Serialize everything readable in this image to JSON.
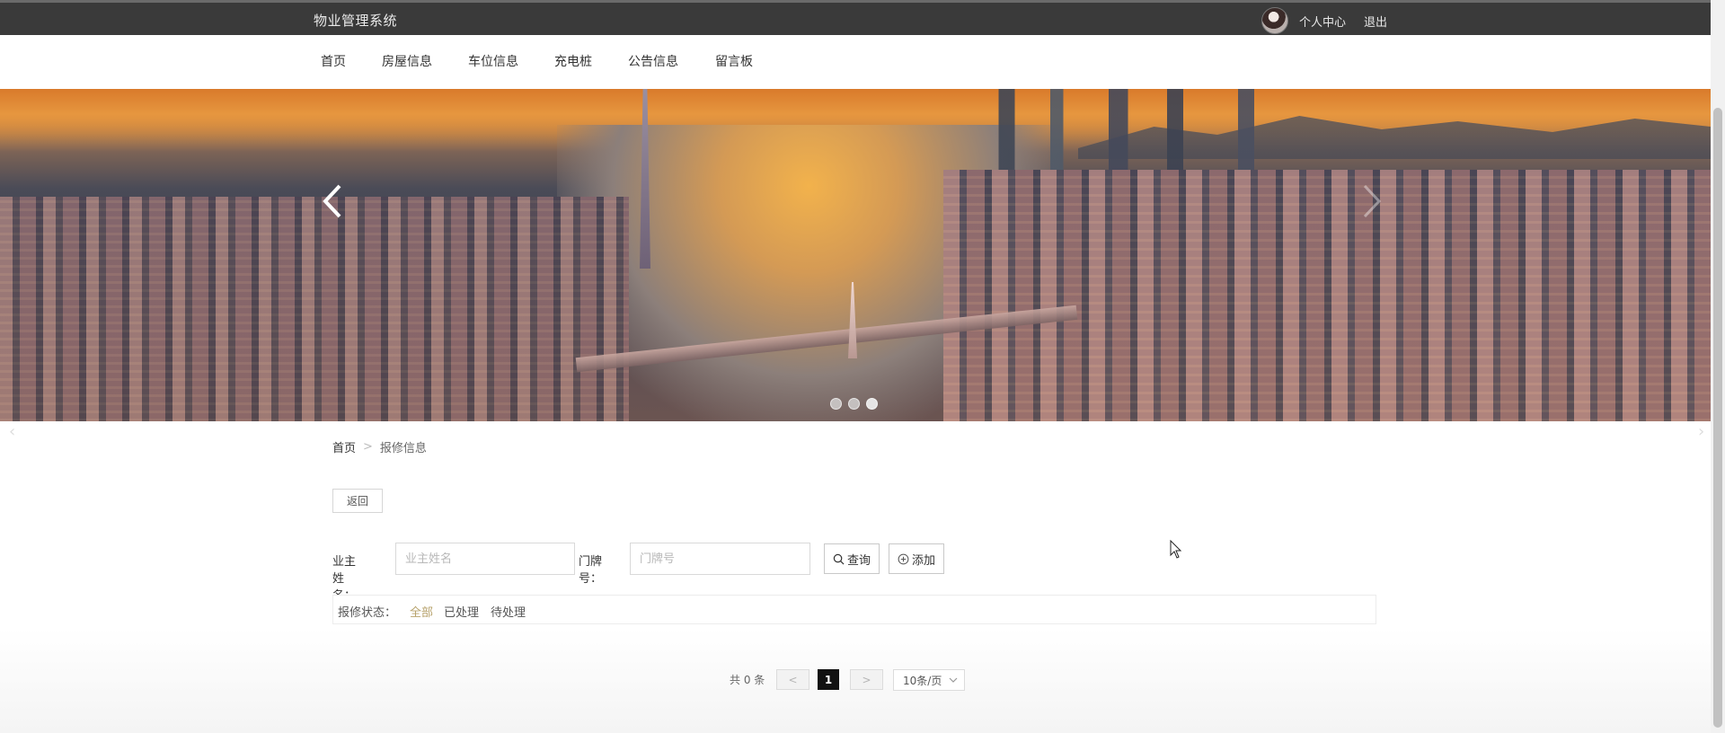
{
  "header": {
    "title": "物业管理系统",
    "personal_center": "个人中心",
    "logout": "退出"
  },
  "nav": {
    "items": [
      "首页",
      "房屋信息",
      "车位信息",
      "充电桩",
      "公告信息",
      "留言板"
    ]
  },
  "banner": {
    "slide_count": 3,
    "active_slide": 3
  },
  "breadcrumb": {
    "home": "首页",
    "separator": ">",
    "current": "报修信息"
  },
  "actions": {
    "back": "返回"
  },
  "search": {
    "owner_label": "业主姓名：",
    "owner_placeholder": "业主姓名",
    "owner_value": "",
    "door_label": "门牌号：",
    "door_placeholder": "门牌号",
    "door_value": "",
    "query_button": "查询",
    "add_button": "添加"
  },
  "filter": {
    "label": "报修状态：",
    "options": [
      "全部",
      "已处理",
      "待处理"
    ],
    "active": "全部"
  },
  "pagination": {
    "total_text": "共 0 条",
    "prev": "<",
    "current_page": "1",
    "next": ">",
    "page_size": "10条/页"
  },
  "colors": {
    "topbar_bg": "#3a3a3a",
    "accent_active_filter": "#b7a26b",
    "page_active": "#111111"
  }
}
